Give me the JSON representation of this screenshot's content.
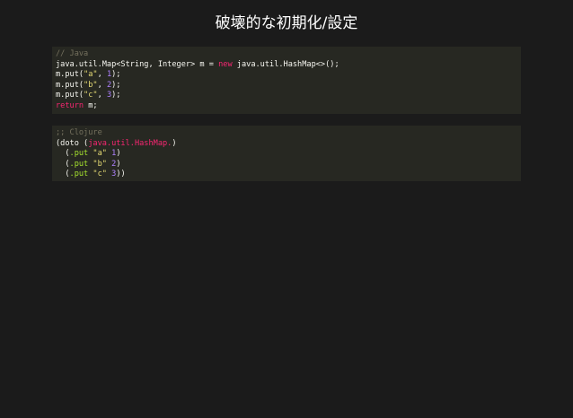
{
  "slide": {
    "title": "破壊的な初期化/設定"
  },
  "colors": {
    "background": "#1b1b1b",
    "code_background": "#272822",
    "text": "#f8f8f2",
    "comment": "#75715e",
    "keyword": "#f92672",
    "string": "#e6db74",
    "number": "#ae81ff",
    "function": "#a6e22e"
  },
  "code_blocks": [
    {
      "name": "java",
      "lines": [
        [
          {
            "t": "// Java",
            "k": "comment"
          }
        ],
        [
          {
            "t": "java.util.Map<String, Integer> m = ",
            "k": "plain"
          },
          {
            "t": "new",
            "k": "keyword"
          },
          {
            "t": " java.util.HashMap<>();",
            "k": "plain"
          }
        ],
        [
          {
            "t": "m.put(",
            "k": "plain"
          },
          {
            "t": "\"a\"",
            "k": "string"
          },
          {
            "t": ", ",
            "k": "plain"
          },
          {
            "t": "1",
            "k": "number"
          },
          {
            "t": ");",
            "k": "plain"
          }
        ],
        [
          {
            "t": "m.put(",
            "k": "plain"
          },
          {
            "t": "\"b\"",
            "k": "string"
          },
          {
            "t": ", ",
            "k": "plain"
          },
          {
            "t": "2",
            "k": "number"
          },
          {
            "t": ");",
            "k": "plain"
          }
        ],
        [
          {
            "t": "m.put(",
            "k": "plain"
          },
          {
            "t": "\"c\"",
            "k": "string"
          },
          {
            "t": ", ",
            "k": "plain"
          },
          {
            "t": "3",
            "k": "number"
          },
          {
            "t": ");",
            "k": "plain"
          }
        ],
        [
          {
            "t": "return",
            "k": "keyword"
          },
          {
            "t": " m;",
            "k": "plain"
          }
        ]
      ]
    },
    {
      "name": "clojure",
      "lines": [
        [
          {
            "t": ";; Clojure",
            "k": "comment"
          }
        ],
        [
          {
            "t": "(doto (",
            "k": "plain"
          },
          {
            "t": "java.util.HashMap.",
            "k": "type"
          },
          {
            "t": ")",
            "k": "plain"
          }
        ],
        [
          {
            "t": "  (",
            "k": "plain"
          },
          {
            "t": ".put",
            "k": "fn"
          },
          {
            "t": " ",
            "k": "plain"
          },
          {
            "t": "\"a\"",
            "k": "string"
          },
          {
            "t": " ",
            "k": "plain"
          },
          {
            "t": "1",
            "k": "number"
          },
          {
            "t": ")",
            "k": "plain"
          }
        ],
        [
          {
            "t": "  (",
            "k": "plain"
          },
          {
            "t": ".put",
            "k": "fn"
          },
          {
            "t": " ",
            "k": "plain"
          },
          {
            "t": "\"b\"",
            "k": "string"
          },
          {
            "t": " ",
            "k": "plain"
          },
          {
            "t": "2",
            "k": "number"
          },
          {
            "t": ")",
            "k": "plain"
          }
        ],
        [
          {
            "t": "  (",
            "k": "plain"
          },
          {
            "t": ".put",
            "k": "fn"
          },
          {
            "t": " ",
            "k": "plain"
          },
          {
            "t": "\"c\"",
            "k": "string"
          },
          {
            "t": " ",
            "k": "plain"
          },
          {
            "t": "3",
            "k": "number"
          },
          {
            "t": "))",
            "k": "plain"
          }
        ]
      ]
    }
  ]
}
